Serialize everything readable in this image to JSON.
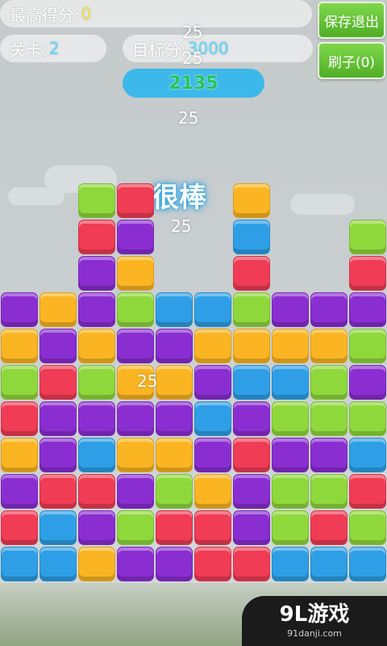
{
  "hud": {
    "best_label": "最高得分:",
    "best_value": "0",
    "level_label": "关卡:",
    "level_value": "2",
    "target_label": "目标分:",
    "target_value": "3000",
    "current_score": "2135"
  },
  "buttons": {
    "save_exit": "保存退出",
    "brush": "刷子(0)"
  },
  "effects": {
    "praise": "很棒",
    "score_popups": [
      "25",
      "25",
      "25",
      "25",
      "25"
    ]
  },
  "colors": {
    "G": "#8fd83c",
    "R": "#f03c55",
    "P": "#8a2ed1",
    "O": "#fbb522",
    "B": "#2e9fe6"
  },
  "board": {
    "columns": [
      "BRPORGOP",
      "BBRPPRPO",
      "OPRBPGOPPRG",
      "PGPOPOPGOPR",
      "PRGOPOPB",
      "RROPBPOB",
      "RPPRPBOGRBO",
      "BGGPGBOP",
      "BRGPGGOP",
      "BGRBGPGPRG"
    ]
  },
  "watermark": {
    "logo": "9L游戏",
    "site": "91danji.com"
  }
}
